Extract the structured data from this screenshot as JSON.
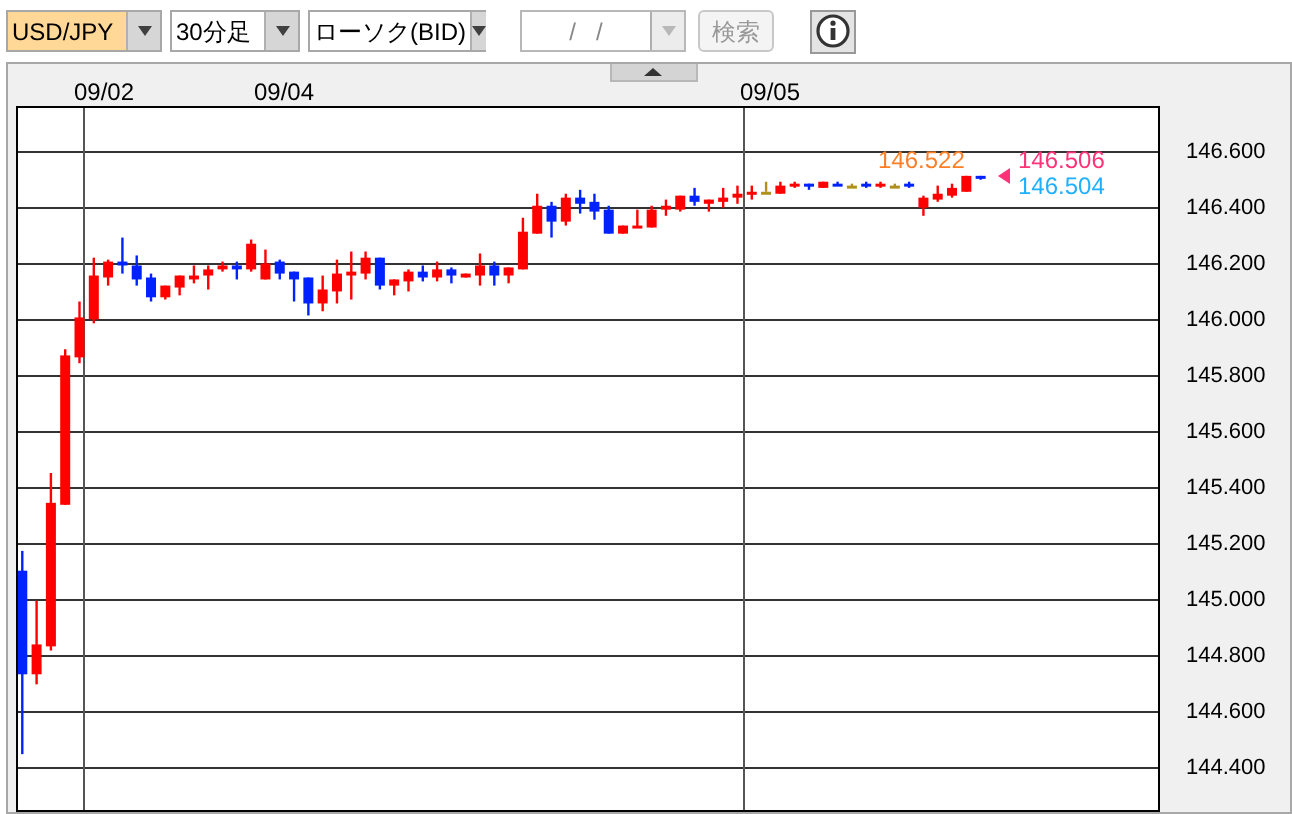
{
  "toolbar": {
    "selects": [
      {
        "value": "USD/JPY",
        "highlighted": true
      },
      {
        "value": "30分足",
        "highlighted": false
      },
      {
        "value": "ローソク(BID)",
        "highlighted": false
      }
    ],
    "date_field": {
      "placeholder": "/   /",
      "disabled": true
    },
    "search_button": {
      "label": "検索",
      "disabled": true
    }
  },
  "chart": {
    "collapse_button": {
      "expanded": true
    },
    "date_labels": [
      "09/02",
      "09/04",
      "09/05"
    ],
    "price_labels": [
      {
        "text": "146.522",
        "color": "#ff7f27",
        "kind": "high"
      },
      {
        "text": "146.506",
        "color": "#ff3377",
        "kind": "ask"
      },
      {
        "text": "146.504",
        "color": "#20b0ff",
        "kind": "bid"
      }
    ],
    "price_axis_labels": [
      "146.600",
      "146.400",
      "146.200",
      "146.000",
      "145.800",
      "145.600",
      "145.400",
      "145.200",
      "145.000",
      "144.800",
      "144.600",
      "144.400"
    ]
  }
}
